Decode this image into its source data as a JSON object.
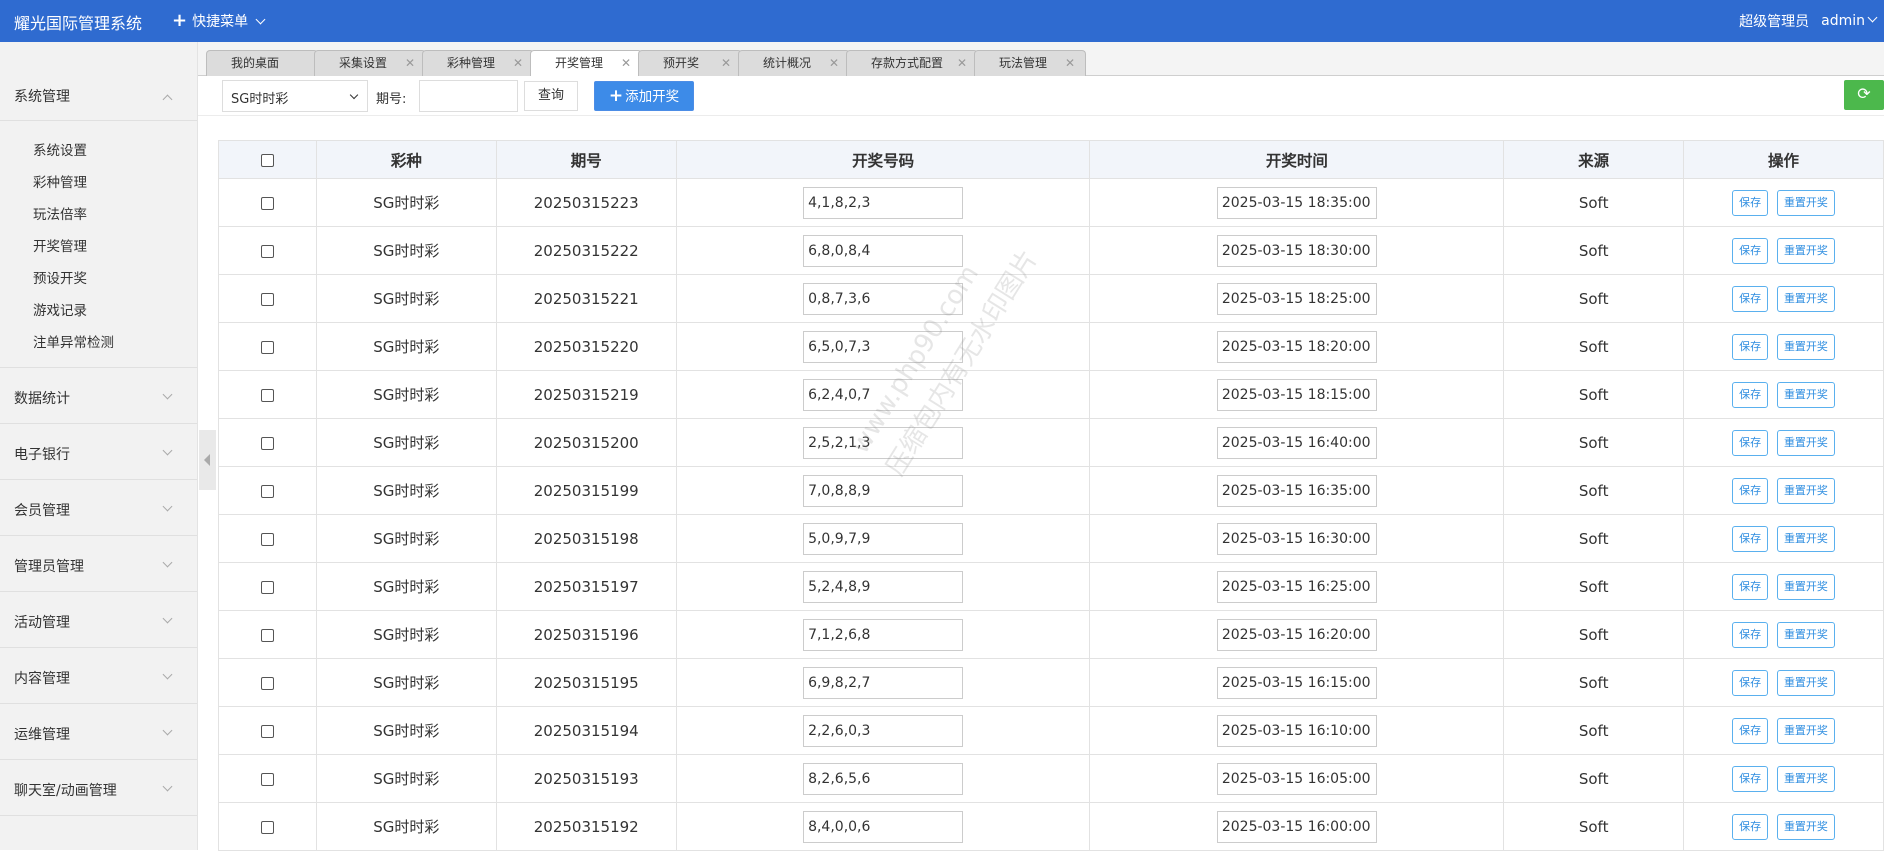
{
  "header": {
    "brand": "耀光国际管理系统",
    "quick_menu": "快捷菜单",
    "role": "超级管理员",
    "user": "admin"
  },
  "sidebar": {
    "groups": [
      {
        "title": "系统管理",
        "open": true,
        "items": [
          "系统设置",
          "彩种管理",
          "玩法倍率",
          "开奖管理",
          "预设开奖",
          "游戏记录",
          "注单异常检测"
        ]
      },
      {
        "title": "数据统计"
      },
      {
        "title": "电子银行"
      },
      {
        "title": "会员管理"
      },
      {
        "title": "管理员管理"
      },
      {
        "title": "活动管理"
      },
      {
        "title": "内容管理"
      },
      {
        "title": "运维管理"
      },
      {
        "title": "聊天室/动画管理"
      }
    ]
  },
  "tabs": [
    {
      "label": "我的桌面"
    },
    {
      "label": "采集设置"
    },
    {
      "label": "彩种管理"
    },
    {
      "label": "开奖管理",
      "active": true
    },
    {
      "label": "预开奖"
    },
    {
      "label": "统计概况"
    },
    {
      "label": "存款方式配置"
    },
    {
      "label": "玩法管理"
    }
  ],
  "toolbar": {
    "lottery_select": "SG时时彩",
    "period_label": "期号:",
    "period_value": "",
    "query_label": "查询",
    "add_label": "添加开奖"
  },
  "table": {
    "headers": [
      "彩种",
      "期号",
      "开奖号码",
      "开奖时间",
      "来源",
      "操作"
    ],
    "save_label": "保存",
    "reset_label": "重置开奖",
    "rows": [
      {
        "lottery": "SG时时彩",
        "period": "20250315223",
        "numbers": "4,1,8,2,3",
        "time": "2025-03-15 18:35:00",
        "source": "Soft"
      },
      {
        "lottery": "SG时时彩",
        "period": "20250315222",
        "numbers": "6,8,0,8,4",
        "time": "2025-03-15 18:30:00",
        "source": "Soft"
      },
      {
        "lottery": "SG时时彩",
        "period": "20250315221",
        "numbers": "0,8,7,3,6",
        "time": "2025-03-15 18:25:00",
        "source": "Soft"
      },
      {
        "lottery": "SG时时彩",
        "period": "20250315220",
        "numbers": "6,5,0,7,3",
        "time": "2025-03-15 18:20:00",
        "source": "Soft"
      },
      {
        "lottery": "SG时时彩",
        "period": "20250315219",
        "numbers": "6,2,4,0,7",
        "time": "2025-03-15 18:15:00",
        "source": "Soft"
      },
      {
        "lottery": "SG时时彩",
        "period": "20250315200",
        "numbers": "2,5,2,1,3",
        "time": "2025-03-15 16:40:00",
        "source": "Soft"
      },
      {
        "lottery": "SG时时彩",
        "period": "20250315199",
        "numbers": "7,0,8,8,9",
        "time": "2025-03-15 16:35:00",
        "source": "Soft"
      },
      {
        "lottery": "SG时时彩",
        "period": "20250315198",
        "numbers": "5,0,9,7,9",
        "time": "2025-03-15 16:30:00",
        "source": "Soft"
      },
      {
        "lottery": "SG时时彩",
        "period": "20250315197",
        "numbers": "5,2,4,8,9",
        "time": "2025-03-15 16:25:00",
        "source": "Soft"
      },
      {
        "lottery": "SG时时彩",
        "period": "20250315196",
        "numbers": "7,1,2,6,8",
        "time": "2025-03-15 16:20:00",
        "source": "Soft"
      },
      {
        "lottery": "SG时时彩",
        "period": "20250315195",
        "numbers": "6,9,8,2,7",
        "time": "2025-03-15 16:15:00",
        "source": "Soft"
      },
      {
        "lottery": "SG时时彩",
        "period": "20250315194",
        "numbers": "2,2,6,0,3",
        "time": "2025-03-15 16:10:00",
        "source": "Soft"
      },
      {
        "lottery": "SG时时彩",
        "period": "20250315193",
        "numbers": "8,2,6,5,6",
        "time": "2025-03-15 16:05:00",
        "source": "Soft"
      },
      {
        "lottery": "SG时时彩",
        "period": "20250315192",
        "numbers": "8,4,0,0,6",
        "time": "2025-03-15 16:00:00",
        "source": "Soft"
      }
    ]
  },
  "watermark": {
    "line1": "www.php90.com",
    "line2": "压缩包内有无水印图片"
  }
}
